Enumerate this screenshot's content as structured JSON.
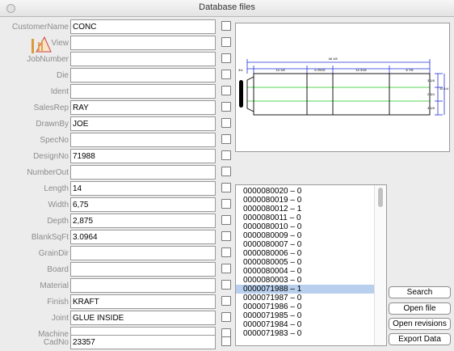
{
  "window": {
    "title": "Database files"
  },
  "form": {
    "fields": [
      {
        "label": "CustomerName",
        "value": "CONC"
      },
      {
        "label": "View",
        "value": ""
      },
      {
        "label": "JobNumber",
        "value": ""
      },
      {
        "label": "Die",
        "value": ""
      },
      {
        "label": "Ident",
        "value": ""
      },
      {
        "label": "SalesRep",
        "value": "RAY"
      },
      {
        "label": "DrawnBy",
        "value": "JOE"
      },
      {
        "label": "SpecNo",
        "value": ""
      },
      {
        "label": "DesignNo",
        "value": "71988"
      },
      {
        "label": "NumberOut",
        "value": ""
      },
      {
        "label": "Length",
        "value": "14"
      },
      {
        "label": "Width",
        "value": "6,75"
      },
      {
        "label": "Depth",
        "value": "2,875"
      },
      {
        "label": "BlankSqFt",
        "value": "3.0964"
      },
      {
        "label": "GrainDir",
        "value": ""
      },
      {
        "label": "Board",
        "value": ""
      },
      {
        "label": "Material",
        "value": ""
      },
      {
        "label": "Finish",
        "value": "KRAFT"
      },
      {
        "label": "Joint",
        "value": "GLUE INSIDE"
      },
      {
        "label": "Machine",
        "value": ""
      },
      {
        "label": "CadNo",
        "value": "23357"
      }
    ]
  },
  "drawing": {
    "overall_width": "48 1/8",
    "segments": [
      "3/4",
      "14 1/8",
      "6 29/32",
      "14 3/16",
      "6 7/8"
    ],
    "right_dims": [
      "3 1/8",
      "2 3/4",
      "3 1/8"
    ],
    "right_total": "10 1/4",
    "icon": "flap-bracket-icon"
  },
  "file_list": {
    "items": [
      "0000080020 – 0",
      "0000080019 – 0",
      "0000080012 – 1",
      "0000080011 – 0",
      "0000080010 – 0",
      "0000080009 – 0",
      "0000080007 – 0",
      "0000080006 – 0",
      "0000080005 – 0",
      "0000080004 – 0",
      "0000080003 – 0",
      "0000071988 – 1",
      "0000071987 – 0",
      "0000071986 – 0",
      "0000071985 – 0",
      "0000071984 – 0",
      "0000071983 – 0"
    ],
    "selected": 11,
    "selected_color": "#b8cfed"
  },
  "buttons": {
    "search": "Search",
    "open_file": "Open file",
    "open_revisions": "Open revisions",
    "export_data": "Export Data"
  },
  "colors": {
    "dimension_lines": "#1f2fd8",
    "score_lines": "#1ec81e"
  }
}
